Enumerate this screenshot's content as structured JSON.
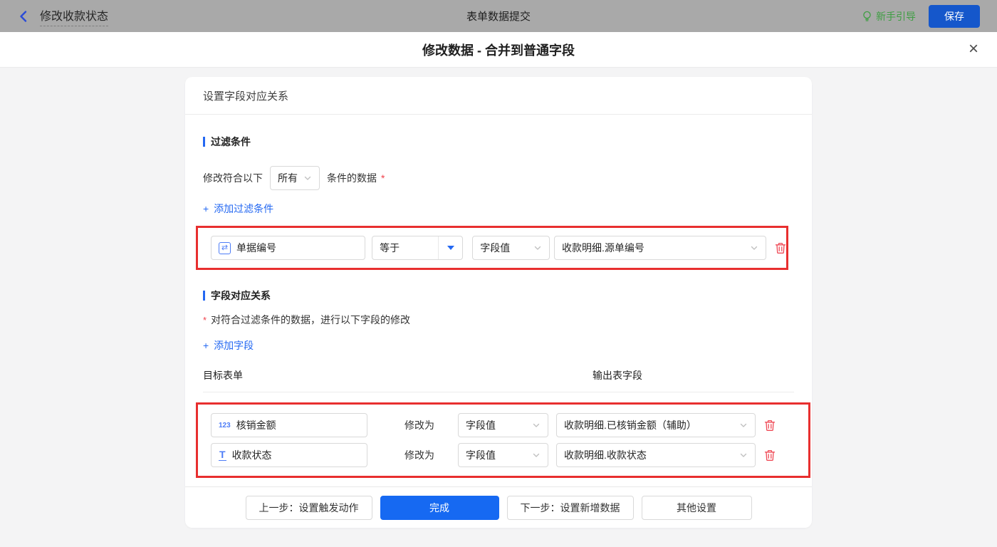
{
  "topbar": {
    "back_title": "修改收款状态",
    "center_title": "表单数据提交",
    "guide_label": "新手引导",
    "save_label": "保存"
  },
  "modal": {
    "title": "修改数据 - 合并到普通字段",
    "close_glyph": "×"
  },
  "card": {
    "header": "设置字段对应关系",
    "filter_section": {
      "title": "过滤条件",
      "condition_prefix": "修改符合以下",
      "condition_select_value": "所有",
      "condition_suffix": "条件的数据",
      "required_mark": "*",
      "add_plus": "+",
      "add_label": "添加过滤条件",
      "row": {
        "field": "单据编号",
        "field_icon_glyph": "⇄",
        "operator": "等于",
        "value_type": "字段值",
        "value": "收款明细.源单编号"
      }
    },
    "mapping_section": {
      "title": "字段对应关系",
      "note_mark": "*",
      "note": "对符合过滤条件的数据，进行以下字段的修改",
      "add_plus": "+",
      "add_label": "添加字段",
      "col_target": "目标表单",
      "col_output": "输出表字段",
      "rows": [
        {
          "field": "核销金额",
          "icon_text": "123",
          "modify_label": "修改为",
          "value_type": "字段值",
          "value": "收款明细.已核销金额（辅助）"
        },
        {
          "field": "收款状态",
          "icon_text": "T",
          "modify_label": "修改为",
          "value_type": "字段值",
          "value": "收款明细.收款状态"
        }
      ]
    },
    "footer": {
      "prev_label": "上一步：设置触发动作",
      "done_label": "完成",
      "next_label": "下一步：设置新增数据",
      "other_label": "其他设置"
    }
  },
  "colors": {
    "accent_blue": "#2468f2",
    "primary_button_blue": "#1669f2",
    "topbar_gray": "#a9a9a9",
    "annotation_red": "#e82f2f",
    "trash_red": "#ef4a56",
    "guide_green": "#3f9e43",
    "required_red": "#f0414b"
  }
}
